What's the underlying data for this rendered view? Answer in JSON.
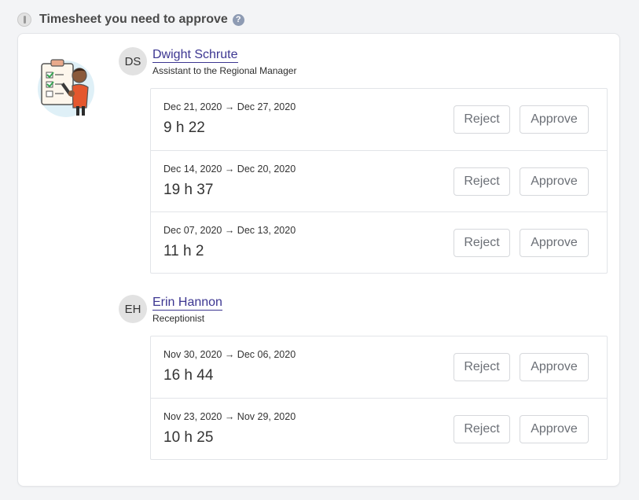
{
  "header": {
    "title": "Timesheet you need to approve",
    "help_glyph": "?"
  },
  "buttons": {
    "reject": "Reject",
    "approve": "Approve"
  },
  "employees": [
    {
      "initials": "DS",
      "name": "Dwight Schrute",
      "role": "Assistant to the Regional Manager",
      "timesheets": [
        {
          "dates": "Dec 21, 2020 → Dec 27, 2020",
          "hours": "9 h 22"
        },
        {
          "dates": "Dec 14, 2020 → Dec 20, 2020",
          "hours": "19 h 37"
        },
        {
          "dates": "Dec 07, 2020 → Dec 13, 2020",
          "hours": "11 h 2"
        }
      ]
    },
    {
      "initials": "EH",
      "name": "Erin Hannon",
      "role": "Receptionist",
      "timesheets": [
        {
          "dates": "Nov 30, 2020 → Dec 06, 2020",
          "hours": "16 h 44"
        },
        {
          "dates": "Nov 23, 2020 → Nov 29, 2020",
          "hours": "10 h 25"
        }
      ]
    }
  ],
  "colors": {
    "link": "#3c3691",
    "background": "#f3f4f6"
  },
  "icons": {
    "header": "timesheet-icon",
    "help": "help-icon",
    "illustration": "clipboard-checklist-illustration"
  }
}
